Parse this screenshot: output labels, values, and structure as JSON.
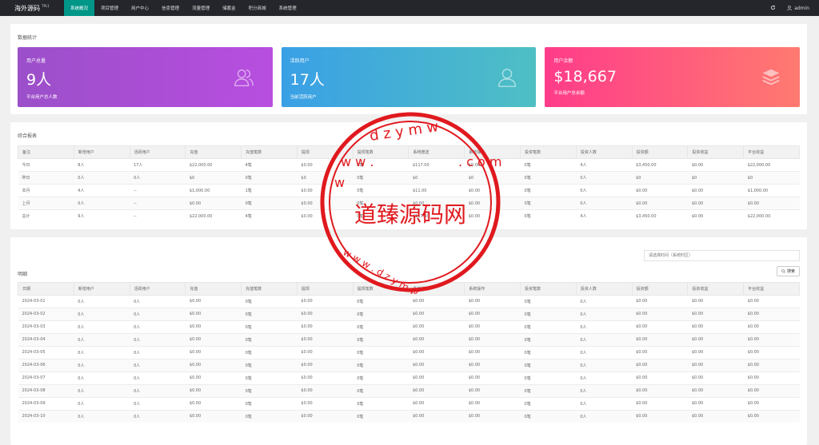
{
  "app": {
    "brand": "海外源码",
    "version": "TPL1"
  },
  "nav": [
    "系统概况",
    "项目管理",
    "用户中心",
    "信息管理",
    "流量管理",
    "储蓄金",
    "积分商城",
    "系统管理"
  ],
  "topRight": {
    "user": "admin"
  },
  "stats": {
    "title": "数据统计",
    "cards": [
      {
        "label": "用户总量",
        "value": "9人",
        "sub": "平台用户总人数",
        "icon": "users-icon"
      },
      {
        "label": "活跃用户",
        "value": "17人",
        "sub": "当前活跃用户",
        "icon": "user-icon"
      },
      {
        "label": "用户余额",
        "value": "$18,667",
        "sub": "平台用户总余额",
        "icon": "layers-icon"
      }
    ]
  },
  "summary": {
    "title": "综合报表",
    "headers": [
      "备注",
      "新增用户",
      "活跃用户",
      "充值",
      "充值笔数",
      "提现",
      "提现笔数",
      "系统赠送",
      "系统操作",
      "投资笔数",
      "投资人数",
      "投资额",
      "投资收益",
      "平台收益"
    ],
    "rows": [
      [
        "今日",
        "8人",
        "17人",
        "$22,000.00",
        "4笔",
        "$0.00",
        "0笔",
        "$117.00",
        "$0.00",
        "0笔",
        "4人",
        "$3,450.00",
        "$0.00",
        "$22,000.00"
      ],
      [
        "昨日",
        "0人",
        "0人",
        "$0",
        "0笔",
        "$0",
        "0笔",
        "$0",
        "$0",
        "0笔",
        "0人",
        "$0",
        "$0",
        "$0"
      ],
      [
        "本月",
        "4人",
        "--",
        "$1,000.00",
        "1笔",
        "$0.00",
        "0笔",
        "$11.00",
        "$0.00",
        "0笔",
        "0人",
        "$0.00",
        "$0.00",
        "$1,000.00"
      ],
      [
        "上月",
        "0人",
        "--",
        "$0.00",
        "0笔",
        "$0.00",
        "0笔",
        "$0.00",
        "$0.00",
        "0笔",
        "0人",
        "$0.00",
        "$0.00",
        "$0.00"
      ],
      [
        "总计",
        "9人",
        "--",
        "$22,000.00",
        "4笔",
        "$0.00",
        "0笔",
        "$117.00",
        "$0.00",
        "0笔",
        "4人",
        "$3,450.00",
        "$0.00",
        "$22,000.00"
      ]
    ]
  },
  "detail": {
    "title": "明细",
    "datePlaceholder": "请选择时间（系统时区）",
    "searchLabel": "搜索",
    "headers": [
      "日期",
      "新增用户",
      "活跃用户",
      "充值",
      "充值笔数",
      "提现",
      "提现笔数",
      "系统赠送",
      "系统操作",
      "投资笔数",
      "投资人数",
      "投资额",
      "投资收益",
      "平台收益"
    ],
    "rows": [
      [
        "2024-03-01",
        "0人",
        "0人",
        "$0.00",
        "0笔",
        "$0.00",
        "0笔",
        "$0.00",
        "$0.00",
        "0笔",
        "0人",
        "$0.00",
        "$0.00",
        "$0.00"
      ],
      [
        "2024-03-02",
        "0人",
        "0人",
        "$0.00",
        "0笔",
        "$0.00",
        "0笔",
        "$0.00",
        "$0.00",
        "0笔",
        "0人",
        "$0.00",
        "$0.00",
        "$0.00"
      ],
      [
        "2024-03-03",
        "0人",
        "0人",
        "$0.00",
        "0笔",
        "$0.00",
        "0笔",
        "$0.00",
        "$0.00",
        "0笔",
        "0人",
        "$0.00",
        "$0.00",
        "$0.00"
      ],
      [
        "2024-03-04",
        "0人",
        "0人",
        "$0.00",
        "0笔",
        "$0.00",
        "0笔",
        "$0.00",
        "$0.00",
        "0笔",
        "0人",
        "$0.00",
        "$0.00",
        "$0.00"
      ],
      [
        "2024-03-05",
        "0人",
        "0人",
        "$0.00",
        "0笔",
        "$0.00",
        "0笔",
        "$0.00",
        "$0.00",
        "0笔",
        "0人",
        "$0.00",
        "$0.00",
        "$0.00"
      ],
      [
        "2024-03-06",
        "0人",
        "0人",
        "$0.00",
        "0笔",
        "$0.00",
        "0笔",
        "$0.00",
        "$0.00",
        "0笔",
        "0人",
        "$0.00",
        "$0.00",
        "$0.00"
      ],
      [
        "2024-03-07",
        "0人",
        "0人",
        "$0.00",
        "0笔",
        "$0.00",
        "0笔",
        "$0.00",
        "$0.00",
        "0笔",
        "0人",
        "$0.00",
        "$0.00",
        "$0.00"
      ],
      [
        "2024-03-08",
        "0人",
        "0人",
        "$0.00",
        "0笔",
        "$0.00",
        "0笔",
        "$0.00",
        "$0.00",
        "0笔",
        "0人",
        "$0.00",
        "$0.00",
        "$0.00"
      ],
      [
        "2024-03-09",
        "0人",
        "0人",
        "$0.00",
        "0笔",
        "$0.00",
        "0笔",
        "$0.00",
        "$0.00",
        "0笔",
        "0人",
        "$0.00",
        "$0.00",
        "$0.00"
      ],
      [
        "2024-03-10",
        "0人",
        "0人",
        "$0.00",
        "0笔",
        "$0.00",
        "0笔",
        "$0.00",
        "$0.00",
        "0笔",
        "0人",
        "$0.00",
        "$0.00",
        "$0.00"
      ]
    ]
  },
  "watermark": {
    "text": "道臻源码网",
    "url": "www.dzymw.com",
    "color": "#e0191e"
  }
}
